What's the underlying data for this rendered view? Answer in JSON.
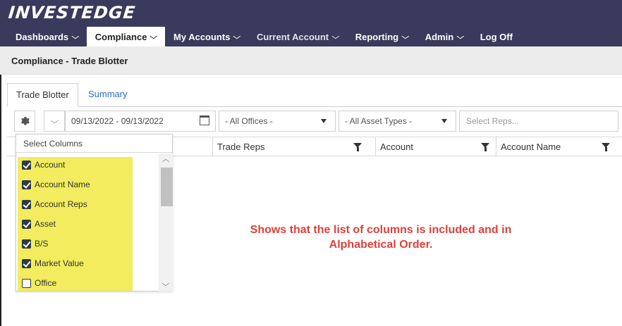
{
  "app": {
    "logo_text": "INVESTEDGE"
  },
  "nav": {
    "items": [
      {
        "label": "Dashboards",
        "chevron": "chevron-down-icon"
      },
      {
        "label": "Compliance",
        "chevron": "chevron-down-icon",
        "active": true
      },
      {
        "label": "My Accounts",
        "chevron": "chevron-down-icon"
      },
      {
        "label": "Current Account",
        "chevron": "chevron-down-icon"
      },
      {
        "label": "Reporting",
        "chevron": "chevron-down-icon"
      },
      {
        "label": "Admin",
        "chevron": "chevron-down-icon"
      },
      {
        "label": "Log Off"
      }
    ]
  },
  "breadcrumb": {
    "text": "Compliance - Trade Blotter"
  },
  "tabs": [
    {
      "label": "Trade Blotter",
      "active": true
    },
    {
      "label": "Summary",
      "active": false
    }
  ],
  "toolbar": {
    "date_range": "09/13/2022 - 09/13/2022",
    "offices": "- All Offices -",
    "asset_types": "- All Asset Types -",
    "reps_placeholder": "Select Reps..."
  },
  "grid": {
    "columns": [
      "Trade Reps",
      "Account",
      "Account Name"
    ]
  },
  "column_chooser": {
    "title": "Select Columns",
    "options": [
      {
        "label": "Account",
        "checked": true
      },
      {
        "label": "Account Name",
        "checked": true
      },
      {
        "label": "Account Reps",
        "checked": true
      },
      {
        "label": "Asset",
        "checked": true
      },
      {
        "label": "B/S",
        "checked": true
      },
      {
        "label": "Market Value",
        "checked": true
      },
      {
        "label": "Office",
        "checked": false
      }
    ]
  },
  "annotation": {
    "line1": "Shows that the list of columns is included and in",
    "line2": "Alphabetical Order."
  },
  "colors": {
    "nav_bg": "#3a3a5c",
    "highlight": "#f2ec5e",
    "annotation": "#e0403a",
    "link": "#2a6fc9"
  }
}
